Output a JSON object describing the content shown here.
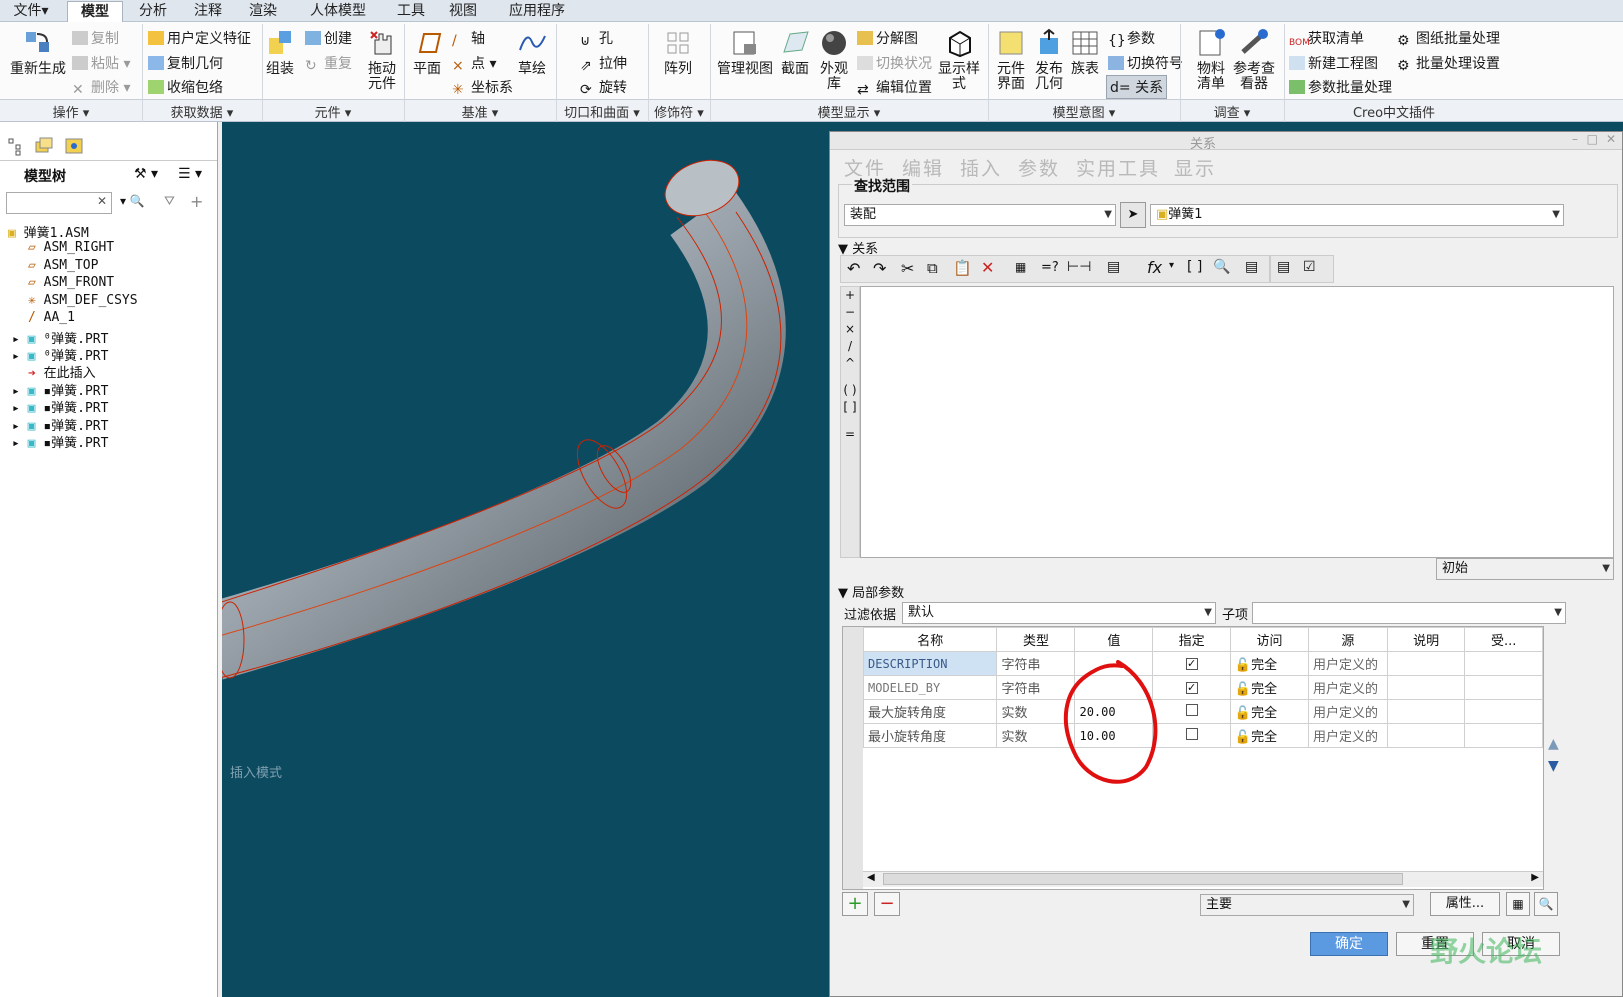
{
  "tabs": [
    "文件▾",
    "模型",
    "分析",
    "注释",
    "渲染",
    "人体模型",
    "工具",
    "视图",
    "应用程序"
  ],
  "ribbon": {
    "regenerate": "重新生成",
    "copy": "复制",
    "paste": "粘贴",
    "delete": "删除",
    "udf": "用户定义特征",
    "copy_geom": "复制几何",
    "shrinkwrap": "收缩包络",
    "assemble": "组装",
    "create": "创建",
    "repeat": "重复",
    "drag": "拖动元件",
    "plane": "平面",
    "axis": "轴",
    "point": "点",
    "csys": "坐标系",
    "sketch": "草绘",
    "hole": "孔",
    "extrude": "拉伸",
    "revolve": "旋转",
    "pattern": "阵列",
    "manage_views": "管理视图",
    "section": "截面",
    "appearance": "外观库",
    "explode": "分解图",
    "toggle_status": "切换状况",
    "edit_position": "编辑位置",
    "display_style": "显示样式",
    "comp_interface": "元件界面",
    "publish_geom": "发布几何",
    "family_table": "族表",
    "params": "参数",
    "switch_symbols": "切换符号",
    "relations": "d= 关系",
    "bom": "物料清单",
    "ref_viewer": "参考查看器",
    "get_bom": "获取清单",
    "new_drawing": "新建工程图",
    "param_batch": "参数批量处理",
    "drawing_batch": "图纸批量处理",
    "batch_settings": "批量处理设置"
  },
  "groups": [
    "操作 ▾",
    "获取数据 ▾",
    "元件 ▾",
    "基准 ▾",
    "切口和曲面 ▾",
    "修饰符 ▾",
    "模型显示 ▾",
    "模型意图 ▾",
    "调查 ▾",
    "Creo中文插件"
  ],
  "model_tree": {
    "title": "模型树",
    "items": [
      "弹簧1.ASM",
      "ASM_RIGHT",
      "ASM_TOP",
      "ASM_FRONT",
      "ASM_DEF_CSYS",
      "AA_1",
      "⁰弹簧.PRT",
      "⁰弹簧.PRT",
      "在此插入",
      "▪弹簧.PRT",
      "▪弹簧.PRT",
      "▪弹簧.PRT",
      "▪弹簧.PRT"
    ]
  },
  "viewport": {
    "status": "插入模式"
  },
  "dialog": {
    "title": "关系",
    "menu": [
      "文件",
      "编辑",
      "插入",
      "参数",
      "实用工具",
      "显示"
    ],
    "lookin_label": "查找范围",
    "scope": "装配",
    "object": "弹簧1",
    "relations_label": "关系",
    "initial": "初始",
    "local_params_label": "局部参数",
    "filter_label": "过滤依据",
    "filter_value": "默认",
    "subitem_label": "子项",
    "columns": [
      "名称",
      "类型",
      "值",
      "指定",
      "访问",
      "源",
      "说明",
      "受..."
    ],
    "rows": [
      {
        "name": "DESCRIPTION",
        "type": "字符串",
        "value": "",
        "designated": true,
        "access": "完全",
        "source": "用户定义的"
      },
      {
        "name": "MODELED_BY",
        "type": "字符串",
        "value": "",
        "designated": true,
        "access": "完全",
        "source": "用户定义的"
      },
      {
        "name": "最大旋转角度",
        "type": "实数",
        "value": "20.00",
        "designated": false,
        "access": "完全",
        "source": "用户定义的"
      },
      {
        "name": "最小旋转角度",
        "type": "实数",
        "value": "10.00",
        "designated": false,
        "access": "完全",
        "source": "用户定义的"
      }
    ],
    "main_combo": "主要",
    "properties_btn": "属性...",
    "ok": "确定",
    "reset": "重置",
    "cancel": "取消"
  },
  "watermark": "野火论坛"
}
